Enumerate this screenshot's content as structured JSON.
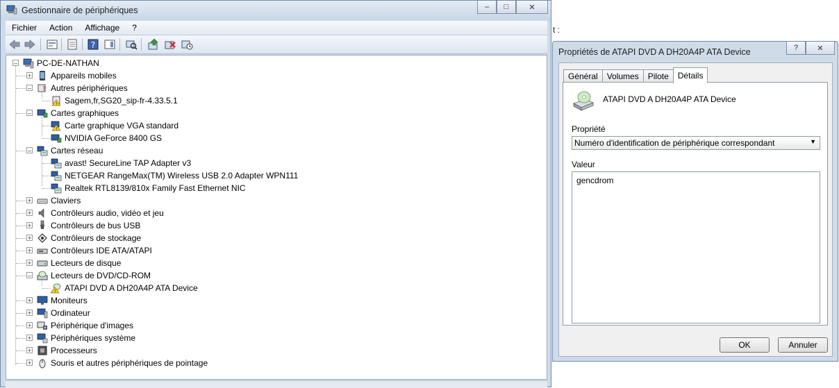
{
  "device_manager": {
    "title": "Gestionnaire de périphériques",
    "window_buttons": {
      "minimize": "–",
      "maximize": "□",
      "close": "✕"
    },
    "menu": [
      "Fichier",
      "Action",
      "Affichage",
      "?"
    ],
    "tree": {
      "root": "PC-DE-NATHAN",
      "items": [
        {
          "label": "Appareils mobiles",
          "level": 1,
          "expander": "+",
          "icon": "mobile-device-icon"
        },
        {
          "label": "Autres périphériques",
          "level": 1,
          "expander": "–",
          "icon": "unknown-device-icon"
        },
        {
          "label": "Sagem,fr,SG20_sip-fr-4.33.5.1",
          "level": 2,
          "icon": "warning-device-icon"
        },
        {
          "label": "Cartes graphiques",
          "level": 1,
          "expander": "–",
          "icon": "display-adapter-icon"
        },
        {
          "label": "Carte graphique VGA standard",
          "level": 2,
          "icon": "warning-display-icon"
        },
        {
          "label": "NVIDIA GeForce 8400 GS",
          "level": 2,
          "icon": "display-adapter-icon"
        },
        {
          "label": "Cartes réseau",
          "level": 1,
          "expander": "–",
          "icon": "network-adapter-icon"
        },
        {
          "label": "avast! SecureLine TAP Adapter v3",
          "level": 2,
          "icon": "network-adapter-icon"
        },
        {
          "label": "NETGEAR RangeMax(TM) Wireless USB 2.0 Adapter WPN111",
          "level": 2,
          "icon": "network-adapter-icon"
        },
        {
          "label": "Realtek RTL8139/810x Family Fast Ethernet NIC",
          "level": 2,
          "icon": "network-adapter-icon"
        },
        {
          "label": "Claviers",
          "level": 1,
          "expander": "+",
          "icon": "keyboard-icon"
        },
        {
          "label": "Contrôleurs audio, vidéo et jeu",
          "level": 1,
          "expander": "+",
          "icon": "speaker-icon"
        },
        {
          "label": "Contrôleurs de bus USB",
          "level": 1,
          "expander": "+",
          "icon": "usb-icon"
        },
        {
          "label": "Contrôleurs de stockage",
          "level": 1,
          "expander": "+",
          "icon": "storage-controller-icon"
        },
        {
          "label": "Contrôleurs IDE ATA/ATAPI",
          "level": 1,
          "expander": "+",
          "icon": "ide-controller-icon"
        },
        {
          "label": "Lecteurs de disque",
          "level": 1,
          "expander": "+",
          "icon": "disk-drive-icon"
        },
        {
          "label": "Lecteurs de DVD/CD-ROM",
          "level": 1,
          "expander": "–",
          "icon": "dvd-drive-icon"
        },
        {
          "label": "ATAPI DVD A  DH20A4P ATA Device",
          "level": 2,
          "icon": "warning-dvd-icon"
        },
        {
          "label": "Moniteurs",
          "level": 1,
          "expander": "+",
          "icon": "monitor-icon"
        },
        {
          "label": "Ordinateur",
          "level": 1,
          "expander": "+",
          "icon": "computer-icon"
        },
        {
          "label": "Périphérique d'images",
          "level": 1,
          "expander": "+",
          "icon": "camera-icon"
        },
        {
          "label": "Périphériques système",
          "level": 1,
          "expander": "+",
          "icon": "system-device-icon"
        },
        {
          "label": "Processeurs",
          "level": 1,
          "expander": "+",
          "icon": "processor-icon"
        },
        {
          "label": "Souris et autres périphériques de pointage",
          "level": 1,
          "expander": "+",
          "icon": "mouse-icon"
        }
      ]
    }
  },
  "background_text": "t :",
  "properties_dialog": {
    "title": "Propriétés de ATAPI DVD A  DH20A4P ATA Device",
    "window_buttons": {
      "help": "?",
      "close": "✕"
    },
    "tabs": [
      {
        "label": "Général",
        "active": false
      },
      {
        "label": "Volumes",
        "active": false
      },
      {
        "label": "Pilote",
        "active": false
      },
      {
        "label": "Détails",
        "active": true
      }
    ],
    "device_name": "ATAPI DVD A  DH20A4P ATA Device",
    "property_label": "Propriété",
    "property_selected": "Numéro d'identification de périphérique correspondant",
    "value_label": "Valeur",
    "values": [
      "gencdrom"
    ],
    "ok_label": "OK",
    "cancel_label": "Annuler"
  }
}
